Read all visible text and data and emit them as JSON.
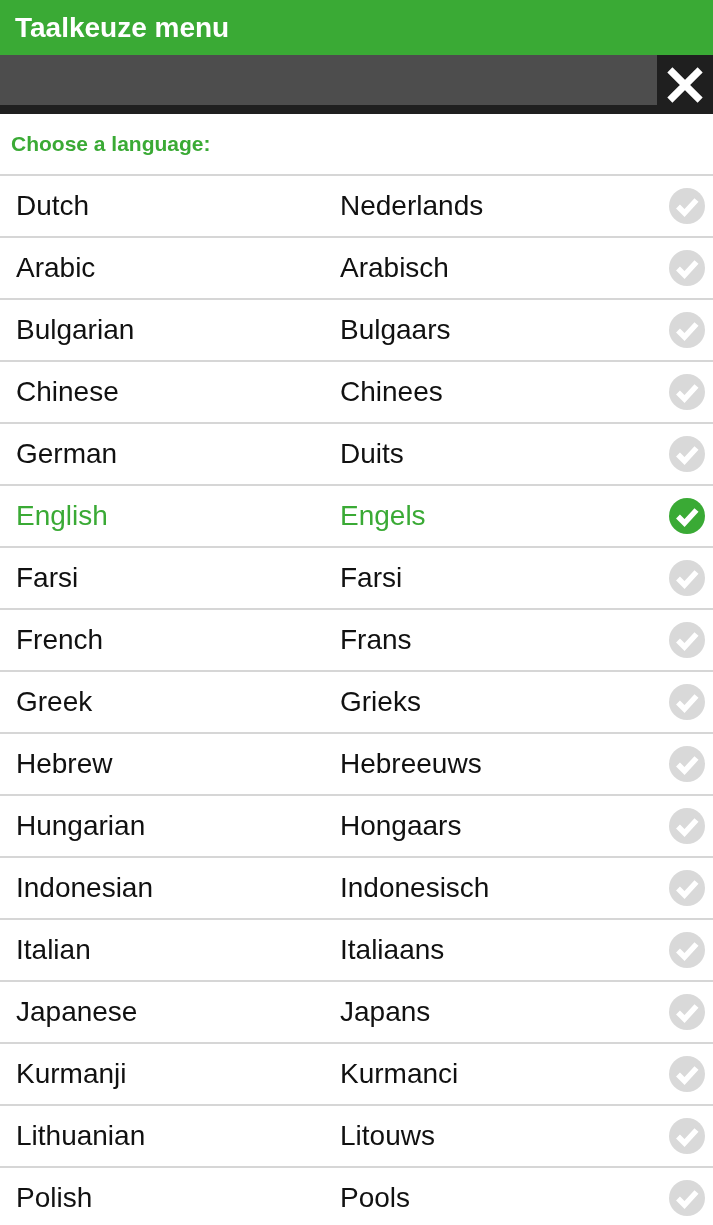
{
  "window": {
    "title": "Taalkeuze menu"
  },
  "prompt": "Choose a language:",
  "languages": [
    {
      "name": "Dutch",
      "native": "Nederlands",
      "selected": false
    },
    {
      "name": "Arabic",
      "native": "Arabisch",
      "selected": false
    },
    {
      "name": "Bulgarian",
      "native": "Bulgaars",
      "selected": false
    },
    {
      "name": "Chinese",
      "native": "Chinees",
      "selected": false
    },
    {
      "name": "German",
      "native": "Duits",
      "selected": false
    },
    {
      "name": "English",
      "native": "Engels",
      "selected": true
    },
    {
      "name": "Farsi",
      "native": "Farsi",
      "selected": false
    },
    {
      "name": "French",
      "native": "Frans",
      "selected": false
    },
    {
      "name": "Greek",
      "native": "Grieks",
      "selected": false
    },
    {
      "name": "Hebrew",
      "native": "Hebreeuws",
      "selected": false
    },
    {
      "name": "Hungarian",
      "native": "Hongaars",
      "selected": false
    },
    {
      "name": "Indonesian",
      "native": "Indonesisch",
      "selected": false
    },
    {
      "name": "Italian",
      "native": "Italiaans",
      "selected": false
    },
    {
      "name": "Japanese",
      "native": "Japans",
      "selected": false
    },
    {
      "name": "Kurmanji",
      "native": "Kurmanci",
      "selected": false
    },
    {
      "name": "Lithuanian",
      "native": "Litouws",
      "selected": false
    },
    {
      "name": "Polish",
      "native": "Pools",
      "selected": false
    }
  ]
}
